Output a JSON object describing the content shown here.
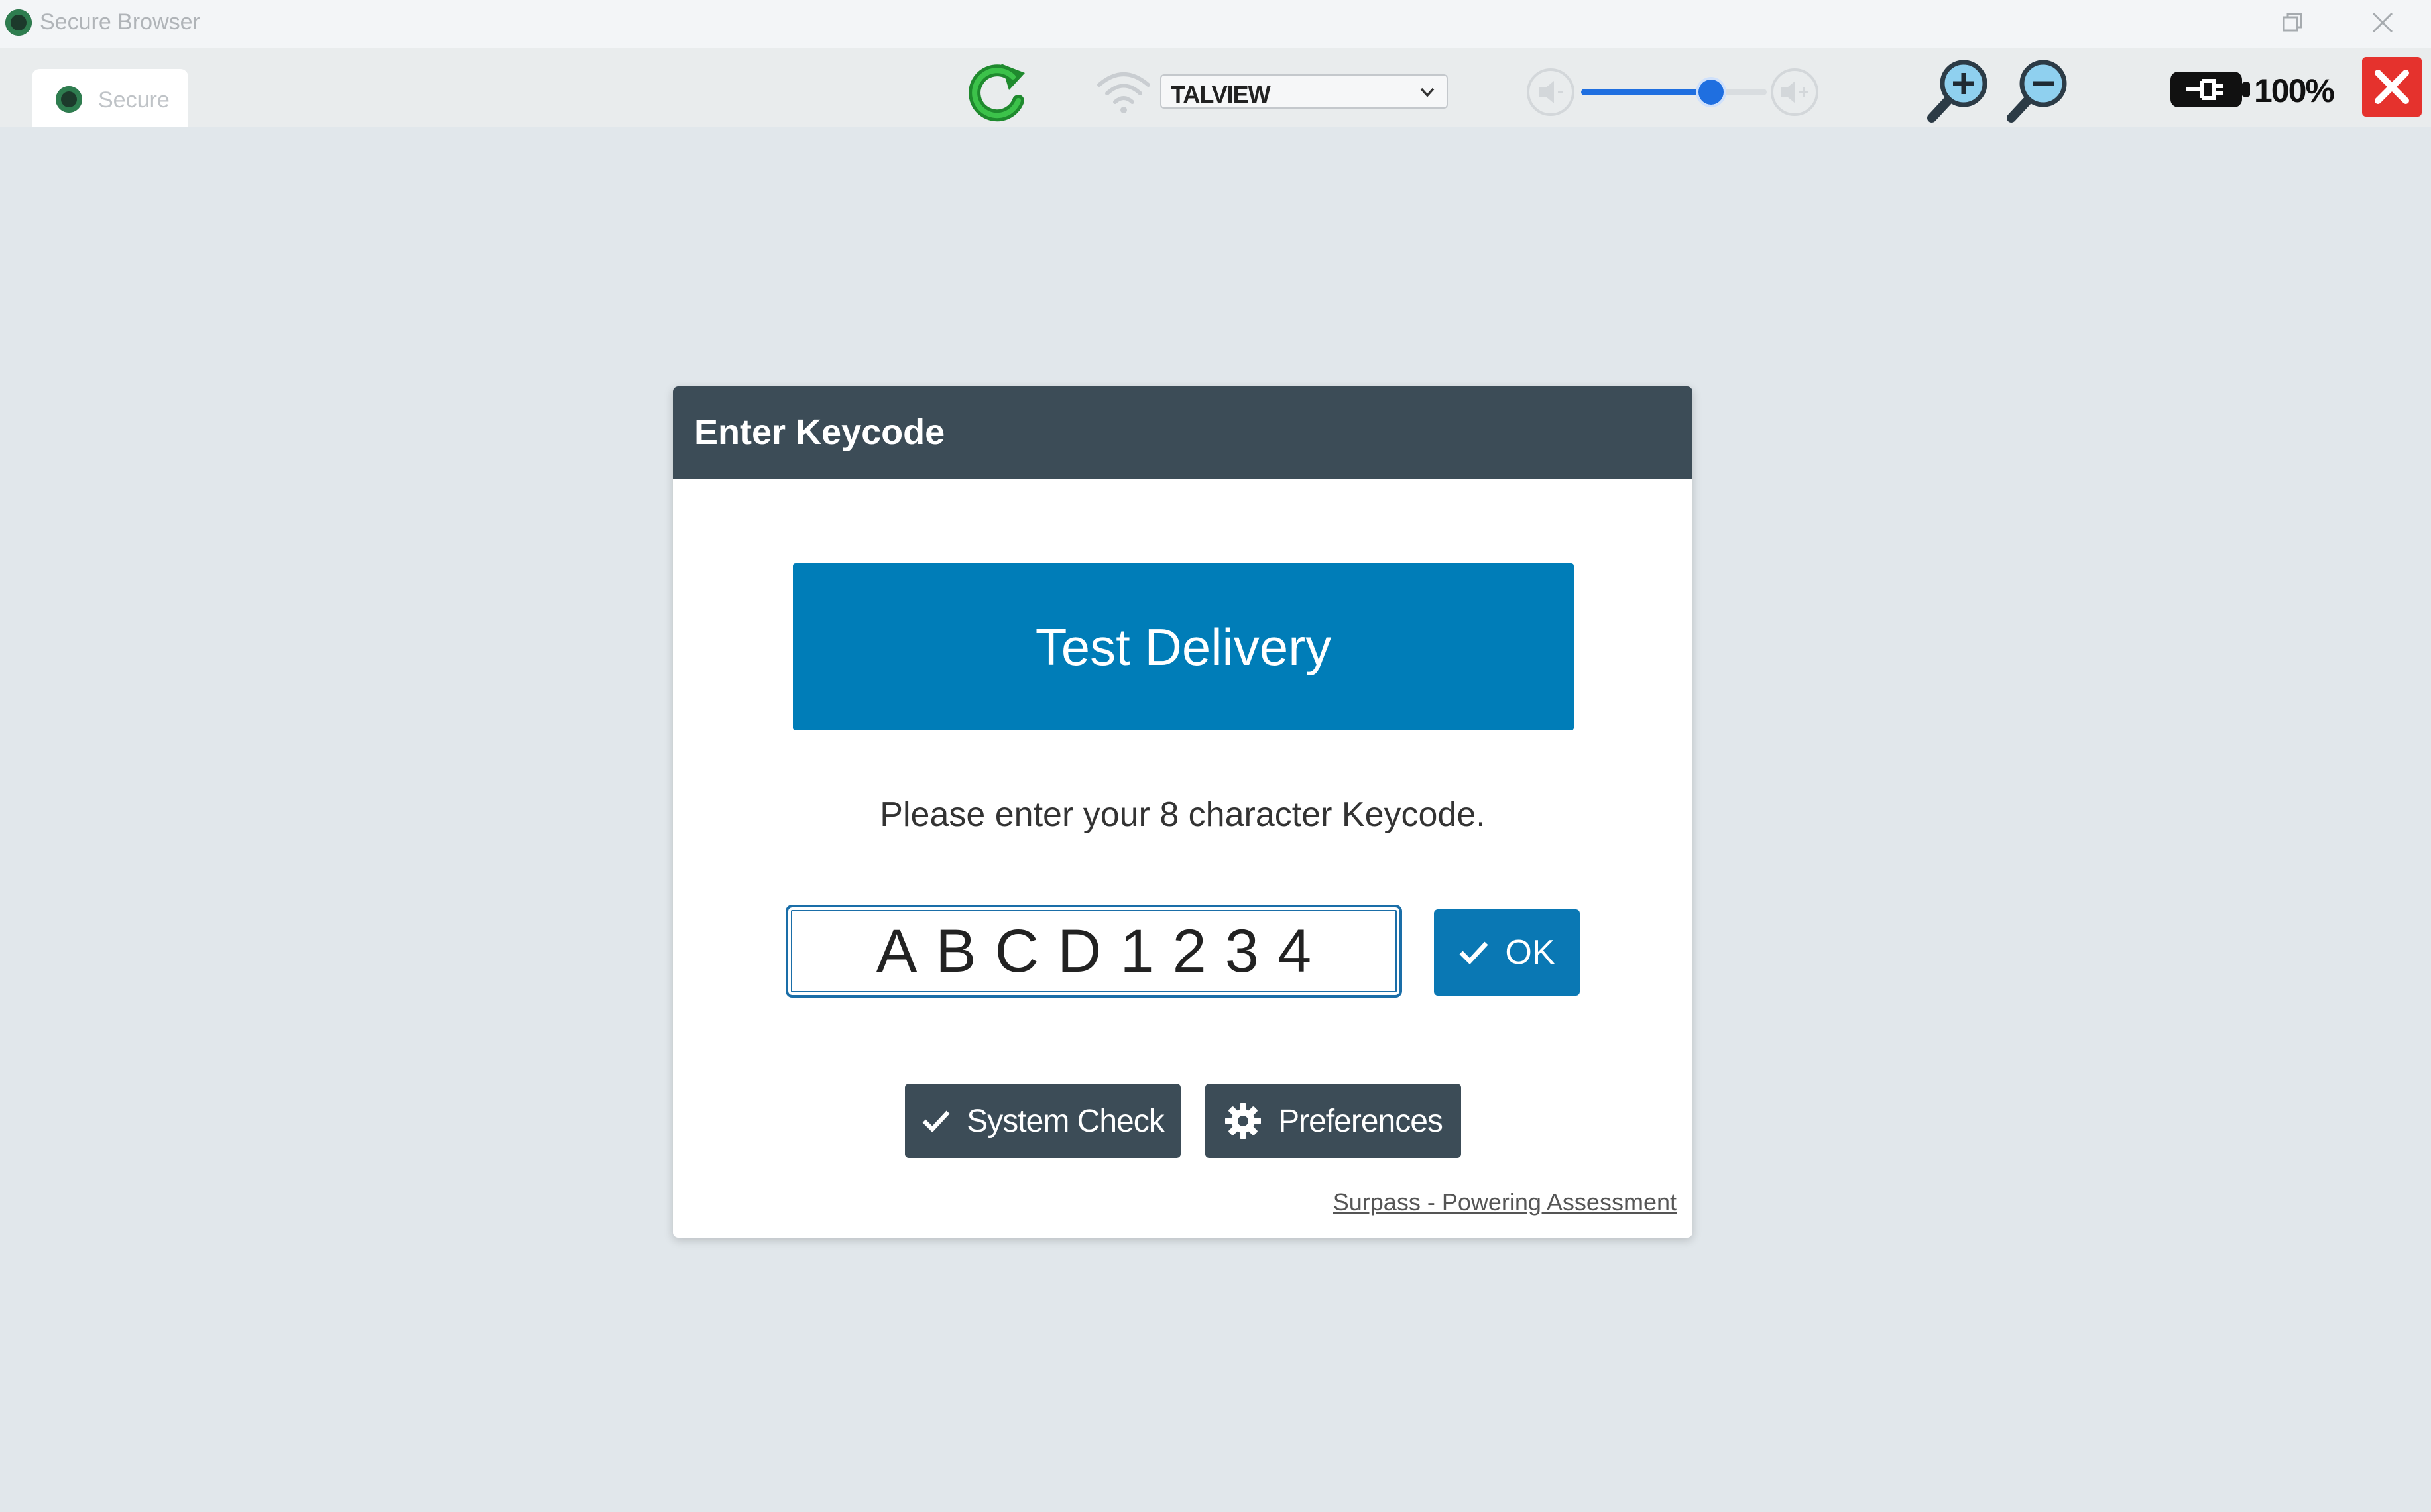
{
  "window": {
    "title": "Secure Browser",
    "icon": "secure-browser-logo",
    "controls": {
      "restore": "restore-icon",
      "close": "close-icon"
    }
  },
  "tab": {
    "label": "Secure"
  },
  "toolbar": {
    "reload_icon": "reload-icon",
    "network_icon": "wifi-icon",
    "network_selected": "TALVIEW",
    "volume_level_percent": 70,
    "zoom_in_icon": "zoom-in-icon",
    "zoom_out_icon": "zoom-out-icon",
    "battery_icon": "battery-charging-icon",
    "zoom_level": "100%",
    "close_app_icon": "close-icon"
  },
  "dialog": {
    "title": "Enter Keycode",
    "banner": "Test Delivery",
    "instruction": "Please enter your 8 character Keycode.",
    "keycode_value": "ABCD1234",
    "ok_label": "OK",
    "system_check_label": "System Check",
    "preferences_label": "Preferences",
    "footer_link": "Surpass - Powering Assessment"
  },
  "colors": {
    "page_background": "#e1e7eb",
    "dialog_header": "#3c4c57",
    "banner": "#007db8",
    "ok_button": "#0a78b4",
    "close_button": "#e5322d"
  }
}
